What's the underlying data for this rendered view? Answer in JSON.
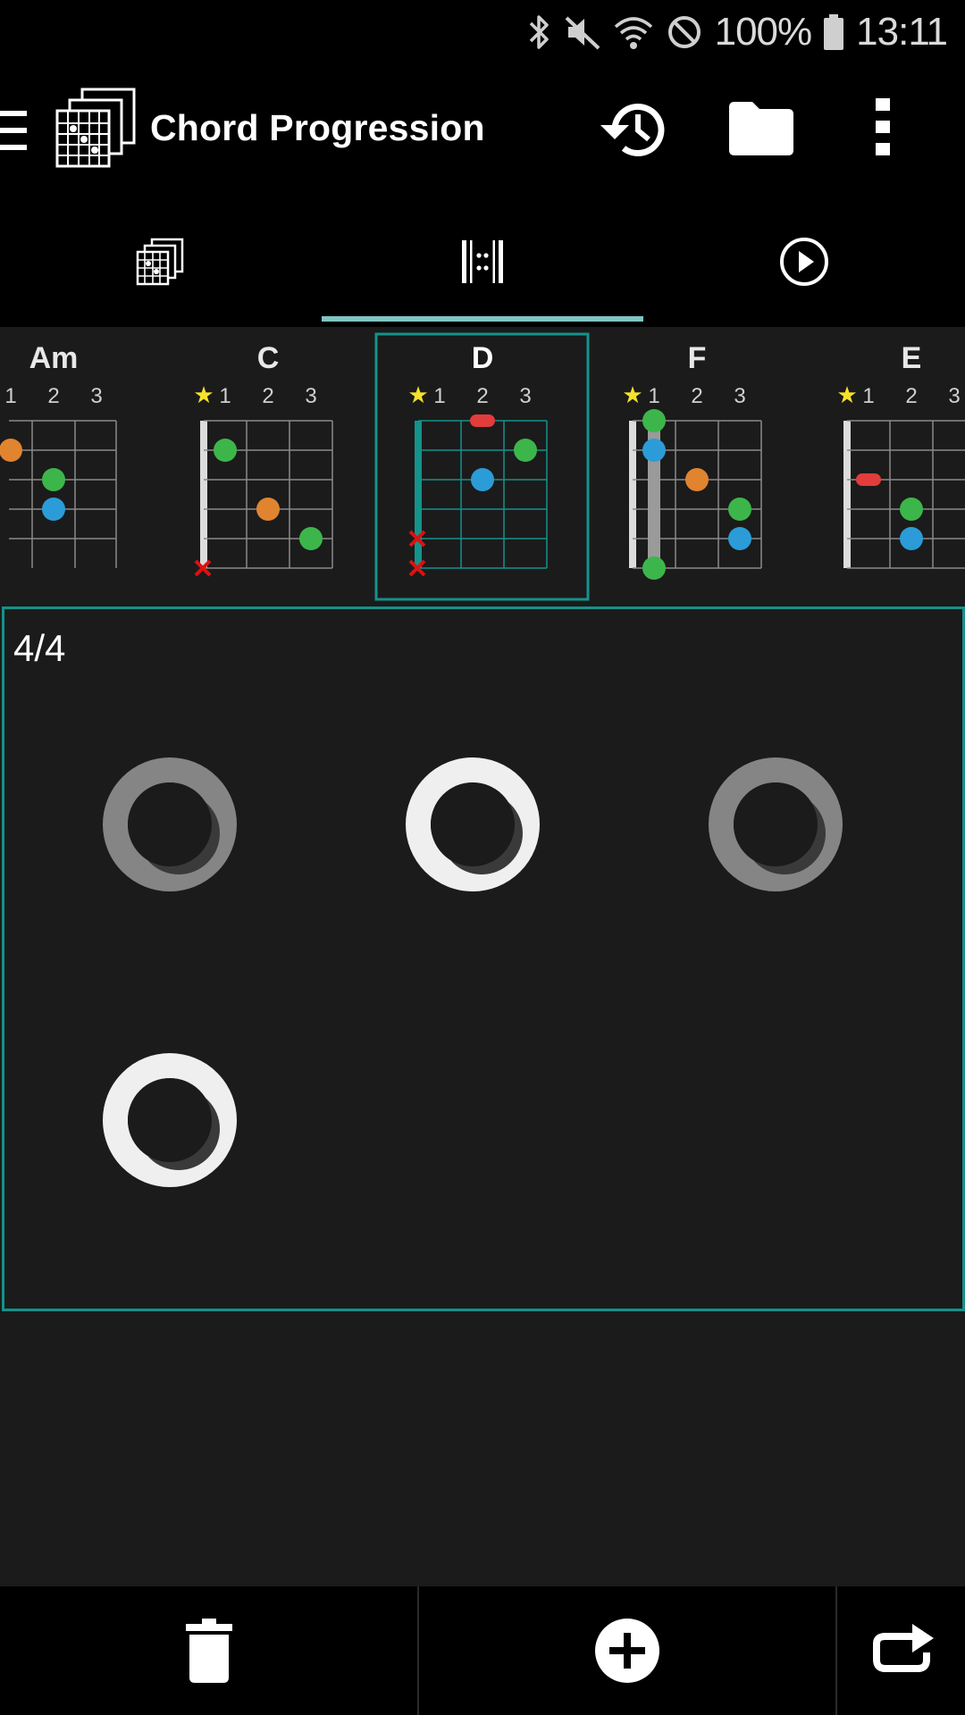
{
  "status": {
    "battery": "100%",
    "time": "13:11"
  },
  "app_bar": {
    "title": "Chord Progression",
    "icons": [
      "menu-icon",
      "chord-sheet-icon",
      "history-icon",
      "folder-icon",
      "more-vert-icon"
    ]
  },
  "tabs": [
    {
      "icon": "chord-library-icon",
      "selected": false
    },
    {
      "icon": "measure-editor-icon",
      "selected": true
    },
    {
      "icon": "play-icon",
      "selected": false
    }
  ],
  "chords": [
    {
      "name": "Am",
      "frets": [
        "1",
        "2",
        "3"
      ],
      "selected": false
    },
    {
      "name": "C",
      "frets": [
        "1",
        "2",
        "3"
      ],
      "selected": false
    },
    {
      "name": "D",
      "frets": [
        "1",
        "2",
        "3"
      ],
      "selected": true
    },
    {
      "name": "F",
      "frets": [
        "1",
        "2",
        "3"
      ],
      "selected": false
    },
    {
      "name": "E",
      "frets": [
        "1",
        "2",
        "3"
      ],
      "selected": false
    }
  ],
  "measure": {
    "time_signature": "4/4",
    "beats": [
      {
        "beat": 1,
        "state": "inactive"
      },
      {
        "beat": 2,
        "state": "active"
      },
      {
        "beat": 3,
        "state": "inactive"
      },
      {
        "beat": 4,
        "state": "active"
      }
    ]
  },
  "bottom_bar": {
    "icons": [
      "trash-icon",
      "add-circle-icon",
      "repeat-icon"
    ]
  },
  "colors": {
    "accent": "#14928b",
    "tab_indicator": "#7fc5c1",
    "green": "#3cb64a",
    "blue": "#2b9cd8",
    "orange": "#e0842f",
    "red": "#e23c3c",
    "star": "#f6e12b"
  }
}
